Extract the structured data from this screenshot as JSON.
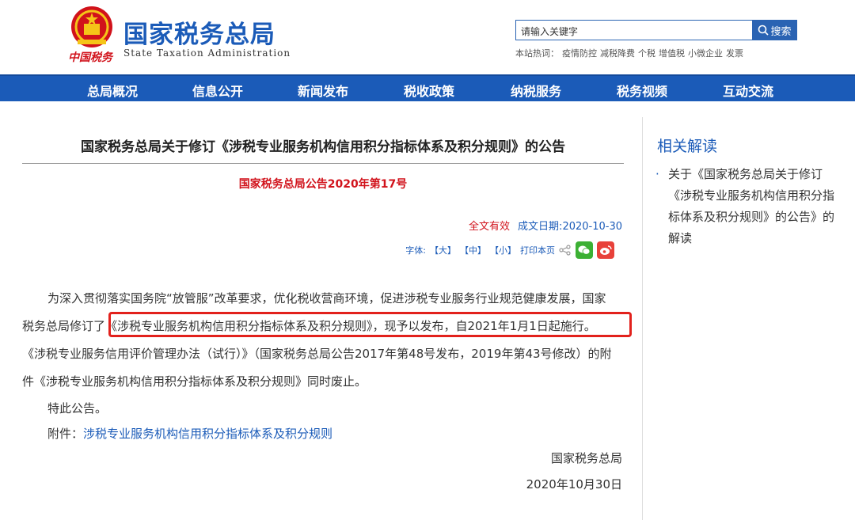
{
  "header": {
    "title": "国家税务总局",
    "subtitle_en": "State Taxation Administration",
    "logo_text": "中国税务",
    "search": {
      "placeholder": "请输入关键字",
      "button_label": "搜索"
    },
    "hot_label": "本站热词：",
    "hot_words": [
      "疫情防控",
      "减税降费",
      "个税",
      "增值税",
      "小微企业",
      "发票"
    ]
  },
  "nav": {
    "items": [
      "总局概况",
      "信息公开",
      "新闻发布",
      "税收政策",
      "纳税服务",
      "税务视频",
      "互动交流"
    ]
  },
  "article": {
    "title": "国家税务总局关于修订《涉税专业服务机构信用积分指标体系及积分规则》的公告",
    "doc_number": "国家税务总局公告2020年第17号",
    "validity": "全文有效",
    "date_label": "成文日期:",
    "date": "2020-10-30",
    "tools": {
      "font_label": "字体:",
      "large": "【大】",
      "medium": "【中】",
      "small": "【小】",
      "print": "打印本页"
    },
    "paragraph1_lines": [
      "为深入贯彻落实国务院“放管服”改革要求，优化税收营商环境，促进涉税专业服务行业规范健康发展，国家",
      "税务总局修订了《涉税专业服务机构信用积分指标体系及积分规则》，现予以发布，自2021年1月1日起施行。",
      "《涉税专业服务信用评价管理办法（试行）》（国家税务总局公告2017年第48号发布，2019年第43号修改）的附",
      "件《涉税专业服务机构信用积分指标体系及积分规则》同时废止。"
    ],
    "paragraph2": "特此公告。",
    "attachment_label": "附件：",
    "attachment_link": "涉税专业服务机构信用积分指标体系及积分规则",
    "signer": "国家税务总局",
    "sign_date": "2020年10月30日"
  },
  "sidebar": {
    "title": "相关解读",
    "items": [
      "关于《国家税务总局关于修订《涉税专业服务机构信用积分指标体系及积分规则》的公告》的解读"
    ]
  },
  "colors": {
    "brand_blue": "#1b5bb8",
    "accent_red": "#d1121b",
    "highlight_red": "#e2211c"
  }
}
